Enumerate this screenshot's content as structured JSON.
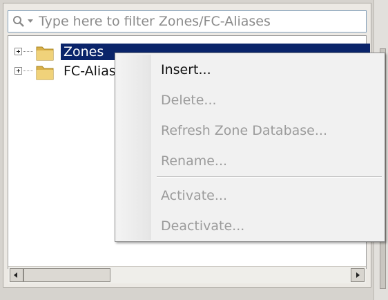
{
  "filter": {
    "placeholder": "Type here to filter Zones/FC-Aliases",
    "icons": [
      "search-icon",
      "dropdown-icon"
    ]
  },
  "tree": {
    "nodes": [
      {
        "label": "Zones",
        "expanded": false,
        "selected": true,
        "icon": "folder-icon"
      },
      {
        "label": "FC-Alias",
        "expanded": false,
        "selected": false,
        "icon": "folder-icon"
      }
    ]
  },
  "context_menu": {
    "items": [
      {
        "label": "Insert...",
        "enabled": true
      },
      {
        "label": "Delete...",
        "enabled": false
      },
      {
        "label": "Refresh Zone Database...",
        "enabled": false
      },
      {
        "label": "Rename...",
        "enabled": false
      },
      {
        "label": "Activate...",
        "enabled": false
      },
      {
        "label": "Deactivate...",
        "enabled": false
      }
    ]
  },
  "colors": {
    "selection": "#0a246a",
    "disabled_text": "#9b9b9b",
    "folder": "#e8c45a"
  }
}
